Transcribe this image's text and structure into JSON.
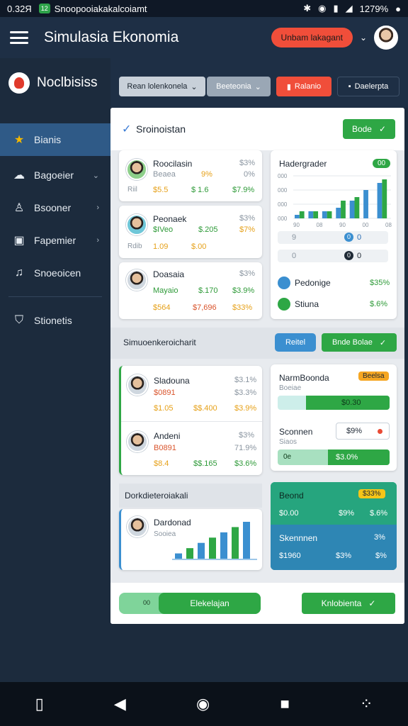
{
  "status": {
    "time": "0.32Я",
    "app_label": "Snoopooiakakalcoiamt",
    "right": "1279%",
    "app_badge": "12"
  },
  "appbar": {
    "title": "Simulasia Ekonomia",
    "upgrade_label": "Unbam lakagant"
  },
  "sidebar": {
    "brand": "Noclbisiss",
    "items": [
      {
        "label": "Bianis",
        "icon": "star-icon"
      },
      {
        "label": "Bagoeier",
        "icon": "cloud-icon"
      },
      {
        "label": "Bsooner",
        "icon": "user-icon"
      },
      {
        "label": "Fapemier",
        "icon": "chart-icon"
      },
      {
        "label": "Snoeoicen",
        "icon": "music-icon"
      },
      {
        "label": "Stionetis",
        "icon": "shield-icon"
      }
    ]
  },
  "toolbar": {
    "select_label": "Rean lolenkonela",
    "select2_label": "Beeteonia",
    "red_button": "Ralanio",
    "dark_button": "Daelerpta"
  },
  "panel": {
    "heading": "Sroinoistan",
    "done_button": "Bode"
  },
  "stats": [
    {
      "name": "Roocilasin",
      "sub": "Beaea",
      "sub_pct": "9%",
      "r1": "$3%",
      "r2": "0%",
      "tag": "Riil",
      "v1": "$5.5",
      "v2": "$ 1.6",
      "v3": "$7.9%"
    },
    {
      "name": "Peonaek",
      "sub": "$IVeo",
      "sub_pct": "$.205",
      "r1": "$3%",
      "r2": "$7%",
      "tag": "Rdib",
      "v1": "1.09",
      "v2": "$.00",
      "v3": ""
    },
    {
      "name": "Doasaia",
      "sub": "Mayaio",
      "sub_pct": "$.170",
      "r1": "$3%",
      "r2": "$3.9%",
      "tag": "",
      "v1": "$564",
      "v2": "$7,696",
      "v3": "$33%"
    }
  ],
  "chart": {
    "title": "Hadergrader",
    "badge": "00",
    "row1": [
      "9",
      "0",
      "0"
    ],
    "row2": [
      "0",
      "0",
      "0"
    ],
    "legend": [
      {
        "label": "Pedonige",
        "value": "$35%"
      },
      {
        "label": "Stiuna",
        "value": "$.6%"
      }
    ]
  },
  "chart_data": {
    "type": "bar",
    "series": [
      {
        "values": [
          1,
          2,
          2,
          3,
          5,
          8,
          10
        ]
      },
      {
        "values": [
          2,
          2,
          2,
          5,
          6,
          0,
          11
        ]
      }
    ],
    "ylim": [
      0,
      12
    ],
    "yticks": [
      "000",
      "000",
      "000",
      "000"
    ],
    "xticks": [
      "90",
      "08",
      "90",
      "00",
      "08"
    ]
  },
  "section2": {
    "title": "Simuoenkeroicharit",
    "btn_blue": "Reitel",
    "btn_green": "Bnde Bolae"
  },
  "people": [
    {
      "name": "Sladouna",
      "code": "$0891",
      "r1": "$3.1%",
      "r2": "$3.3%",
      "v1": "$1.05",
      "v2": "$$.400",
      "v3": "$3.9%"
    },
    {
      "name": "Andeni",
      "code": "B0891",
      "r1": "$3%",
      "r2": "71.9%",
      "v1": "$8.4",
      "v2": "$$.165",
      "v3": "$3.6%"
    }
  ],
  "progress": {
    "title": "NarmBoonda",
    "badge": "Beelsa",
    "sub": "Boeiae",
    "bar1_label": "$0.30",
    "bar1_pct": 0.75,
    "title2": "Sconnen",
    "field": "$9%",
    "sub2": "Siaos",
    "bar2_prefix": "0e",
    "bar2_label": "$3.0%",
    "bar2_pct": 0.55
  },
  "section3": {
    "title": "Dorkdieteroiakali",
    "card_name": "Dardonad",
    "card_sub": "Sooiea",
    "chart_values": [
      1,
      2,
      3,
      4,
      5,
      6,
      7
    ]
  },
  "summary": {
    "title": "Beond",
    "badge": "$33%",
    "v1": "$0.00",
    "v2": "$9%",
    "v3": "$.6%",
    "title2": "Skennnen",
    "pct2": "3%",
    "w1": "$1960",
    "w2": "$3%",
    "w3": "$%"
  },
  "footer": {
    "left_prefix": "00",
    "left_label": "Elekelajan",
    "right_label": "Knlobienta"
  }
}
